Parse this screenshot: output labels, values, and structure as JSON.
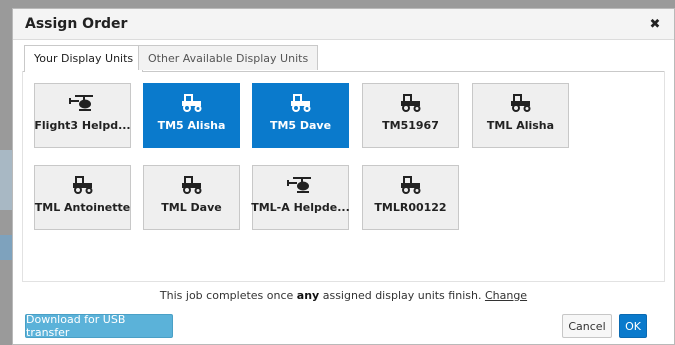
{
  "dialog": {
    "title": "Assign Order",
    "close_icon": "close-icon"
  },
  "tabs": [
    {
      "label": "Your Display Units",
      "active": true
    },
    {
      "label": "Other Available Display Units",
      "active": false
    }
  ],
  "units": [
    {
      "label": "Flight3 Helpd...",
      "icon": "helicopter-icon",
      "selected": false
    },
    {
      "label": "TM5 Alisha",
      "icon": "tractor-icon",
      "selected": true
    },
    {
      "label": "TM5 Dave",
      "icon": "tractor-icon",
      "selected": true
    },
    {
      "label": "TM51967",
      "icon": "tractor-icon",
      "selected": false
    },
    {
      "label": "TML Alisha",
      "icon": "tractor-icon",
      "selected": false
    },
    {
      "label": "TML Antoinette",
      "icon": "tractor-icon",
      "selected": false
    },
    {
      "label": "TML Dave",
      "icon": "tractor-icon",
      "selected": false
    },
    {
      "label": "TML-A Helpde...",
      "icon": "helicopter-icon",
      "selected": false
    },
    {
      "label": "TMLR00122",
      "icon": "tractor-icon",
      "selected": false
    }
  ],
  "footnote": {
    "prefix": "This job completes once",
    "emphasis": "any",
    "suffix": "assigned display units finish.",
    "link": "Change"
  },
  "buttons": {
    "usb": "Download for USB transfer",
    "cancel": "Cancel",
    "ok": "OK"
  },
  "colors": {
    "selected": "#0a7acc",
    "usb_button": "#5bb2d9"
  }
}
